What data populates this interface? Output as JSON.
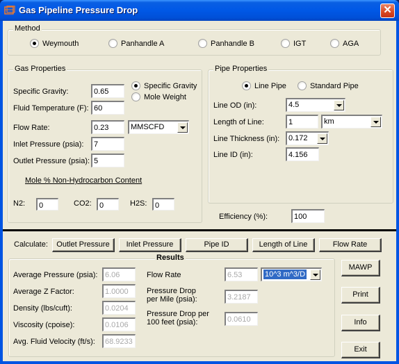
{
  "window": {
    "title": "Gas Pipeline Pressure Drop",
    "icon": "app-window-icon",
    "close_label": "✕"
  },
  "method": {
    "label": "Method",
    "options": [
      {
        "label": "Weymouth",
        "selected": true
      },
      {
        "label": "Panhandle A",
        "selected": false
      },
      {
        "label": "Panhandle B",
        "selected": false
      },
      {
        "label": "IGT",
        "selected": false
      },
      {
        "label": "AGA",
        "selected": false
      }
    ]
  },
  "gas_properties": {
    "label": "Gas Properties",
    "specific_gravity_label": "Specific Gravity:",
    "specific_gravity_value": "0.65",
    "fluid_temperature_label": "Fluid Temperature (F):",
    "fluid_temperature_value": "60",
    "flow_rate_label": "Flow Rate:",
    "flow_rate_value": "0.23",
    "flow_rate_unit": "MMSCFD",
    "inlet_pressure_label": "Inlet Pressure (psia):",
    "inlet_pressure_value": "7",
    "outlet_pressure_label": "Outlet Pressure (psia):",
    "outlet_pressure_value": "5",
    "basis_options": [
      {
        "label": "Specific Gravity",
        "selected": true
      },
      {
        "label": "Mole Weight",
        "selected": false
      }
    ],
    "non_hydrocarbon_link": "Mole % Non-Hydrocarbon Content",
    "n2_label": "N2:",
    "n2_value": "0",
    "co2_label": "CO2:",
    "co2_value": "0",
    "h2s_label": "H2S:",
    "h2s_value": "0"
  },
  "pipe_properties": {
    "label": "Pipe Properties",
    "type_options": [
      {
        "label": "Line Pipe",
        "selected": true
      },
      {
        "label": "Standard Pipe",
        "selected": false
      }
    ],
    "line_od_label": "Line OD (in):",
    "line_od_value": "4.5",
    "length_label": "Length of Line:",
    "length_value": "1",
    "length_unit": "km",
    "thickness_label": "Line Thickness (in):",
    "thickness_value": "0.172",
    "line_id_label": "Line ID (in):",
    "line_id_value": "4.156"
  },
  "efficiency": {
    "label": "Efficiency (%):",
    "value": "100"
  },
  "calculate": {
    "label": "Calculate:",
    "buttons": [
      "Outlet Pressure",
      "Inlet Pressure",
      "Pipe ID",
      "Length of Line",
      "Flow Rate"
    ]
  },
  "results": {
    "label": "Results",
    "average_pressure_label": "Average Pressure (psia):",
    "average_pressure_value": "6.06",
    "average_z_label": "Average Z Factor:",
    "average_z_value": "1.0000",
    "density_label": "Density (lbs/cuft):",
    "density_value": "0.0204",
    "viscosity_label": "Viscosity (cpoise):",
    "viscosity_value": "0.0106",
    "velocity_label": "Avg. Fluid Velocity (ft/s):",
    "velocity_value": "68.9233",
    "flow_rate_label": "Flow Rate",
    "flow_rate_value": "6.53",
    "flow_rate_unit": "10^3 m^3/D",
    "drop_per_mile_label_1": "Pressure Drop",
    "drop_per_mile_label_2": "per Mile (psia):",
    "drop_per_mile_value": "3.2187",
    "drop_per_100ft_label_1": "Pressure Drop per",
    "drop_per_100ft_label_2": "100 feet (psia):",
    "drop_per_100ft_value": "0.0610"
  },
  "side_buttons": {
    "mawp": "MAWP",
    "print": "Print",
    "info": "Info",
    "exit": "Exit"
  }
}
